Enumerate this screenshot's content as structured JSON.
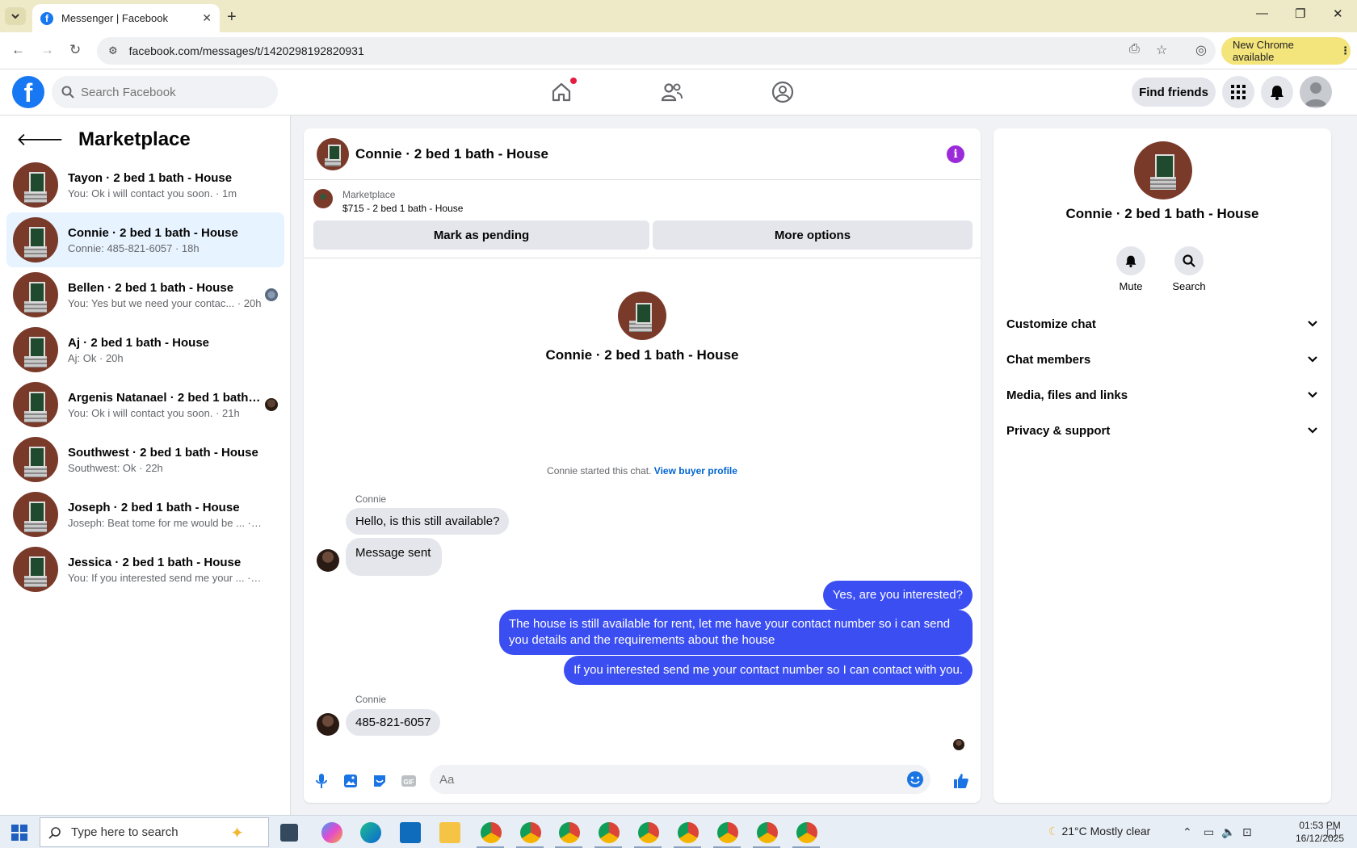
{
  "browser": {
    "tab_title": "Messenger | Facebook",
    "url": "facebook.com/messages/t/1420298192820931",
    "new_chrome_label": "New Chrome available"
  },
  "header": {
    "search_placeholder": "Search Facebook",
    "find_friends": "Find friends"
  },
  "sidebar": {
    "title": "Marketplace",
    "conversations": [
      {
        "name": "Tayon · 2 bed 1 bath - House",
        "preview": "You: Ok i will contact you soon. · 1m"
      },
      {
        "name": "Connie · 2 bed 1 bath - House",
        "preview": "Connie: 485-821-6057 · 18h"
      },
      {
        "name": "Bellen · 2 bed 1 bath - House",
        "preview": "You: Yes but we need your contac... · 20h"
      },
      {
        "name": "Aj · 2 bed 1 bath - House",
        "preview": "Aj: Ok · 20h"
      },
      {
        "name": "Argenis Natanael · 2 bed 1 bath ...",
        "preview": "You: Ok i will contact you soon. · 21h"
      },
      {
        "name": "Southwest · 2 bed 1 bath - House",
        "preview": "Southwest: Ok · 22h"
      },
      {
        "name": "Joseph · 2 bed 1 bath - House",
        "preview": "Joseph: Beat tome for me would be ... · 23h"
      },
      {
        "name": "Jessica · 2 bed 1 bath - House",
        "preview": "You: If you interested send me your ... · 23h"
      }
    ]
  },
  "chat": {
    "title": "Connie · 2 bed 1 bath - House",
    "marketplace_label": "Marketplace",
    "listing": "$715 - 2 bed 1 bath - House",
    "mark_pending": "Mark as pending",
    "more_options": "More options",
    "intro_name": "Connie · 2 bed 1 bath - House",
    "started_text": "Connie started this chat.",
    "view_buyer_profile": "View buyer profile",
    "sender_name": "Connie",
    "messages": {
      "in1": "Hello, is this still available?",
      "in2": "Message sent",
      "out1": "Yes, are you interested?",
      "out2": "The house is still available for rent, let me have your contact number so i can send you details and the requirements about the house",
      "out3": "If you interested send me your contact number so I can contact with you.",
      "in3": "485-821-6057"
    },
    "composer_placeholder": "Aa"
  },
  "right_panel": {
    "name": "Connie · 2 bed 1 bath - House",
    "mute": "Mute",
    "search": "Search",
    "sections": [
      "Customize chat",
      "Chat members",
      "Media, files and links",
      "Privacy & support"
    ]
  },
  "taskbar": {
    "search_placeholder": "Type here to search",
    "weather": "21°C  Mostly clear",
    "time": "01:53 PM",
    "date": "16/12/2025"
  }
}
